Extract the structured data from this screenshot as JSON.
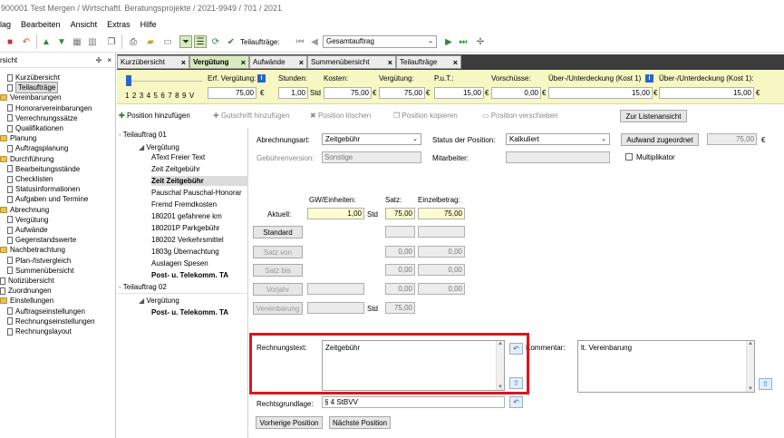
{
  "window": {
    "title": "900001 Test Mergen / Wirtschaftl. Beratungsprojekte / 2021-9949 / 701 / 2021"
  },
  "menu": [
    "lag",
    "Bearbeiten",
    "Ansicht",
    "Extras",
    "Hilfe"
  ],
  "toolbar": {
    "teilauftraege_label": "Teilaufträge:",
    "teilauftrag_value": "Gesamtauftrag"
  },
  "left_panel": {
    "header": "rsicht",
    "items": [
      {
        "label": "Kurzübersicht",
        "type": "doc",
        "indent": 1
      },
      {
        "label": "Teilaufträge",
        "type": "doc",
        "indent": 1,
        "selected": true
      },
      {
        "label": "Vereinbarungen",
        "type": "folder",
        "indent": 0
      },
      {
        "label": "Honorarvereinbarungen",
        "type": "doc",
        "indent": 1
      },
      {
        "label": "Verrechnungssätze",
        "type": "doc",
        "indent": 1
      },
      {
        "label": "Qualifikationen",
        "type": "doc",
        "indent": 1
      },
      {
        "label": "Planung",
        "type": "folder",
        "indent": 0
      },
      {
        "label": "Auftragsplanung",
        "type": "doc",
        "indent": 1
      },
      {
        "label": "Durchführung",
        "type": "folder",
        "indent": 0
      },
      {
        "label": "Bearbeitungsstände",
        "type": "doc",
        "indent": 1
      },
      {
        "label": "Checklisten",
        "type": "doc",
        "indent": 1
      },
      {
        "label": "Statusinformationen",
        "type": "doc",
        "indent": 1
      },
      {
        "label": "Aufgaben und Termine",
        "type": "doc",
        "indent": 1
      },
      {
        "label": "Abrechnung",
        "type": "folder",
        "indent": 0
      },
      {
        "label": "Vergütung",
        "type": "doc",
        "indent": 1
      },
      {
        "label": "Aufwände",
        "type": "doc",
        "indent": 1
      },
      {
        "label": "Gegenstandswerte",
        "type": "doc",
        "indent": 1
      },
      {
        "label": "Nachbetrachtung",
        "type": "folder",
        "indent": 0
      },
      {
        "label": "Plan-/Istvergleich",
        "type": "doc",
        "indent": 1
      },
      {
        "label": "Summenübersicht",
        "type": "doc",
        "indent": 1
      },
      {
        "label": "Notizübersicht",
        "type": "doc",
        "indent": 0
      },
      {
        "label": "Zuordnungen",
        "type": "doc",
        "indent": 0
      },
      {
        "label": "Einstellungen",
        "type": "folder",
        "indent": 0
      },
      {
        "label": "Auftragseinstellungen",
        "type": "doc",
        "indent": 1
      },
      {
        "label": "Rechnungseinstellungen",
        "type": "doc",
        "indent": 1
      },
      {
        "label": "Rechnungslayout",
        "type": "doc",
        "indent": 1
      }
    ]
  },
  "tabs": [
    {
      "label": "Kurzübersicht",
      "active": false
    },
    {
      "label": "Vergütung",
      "active": true
    },
    {
      "label": "Aufwände",
      "active": false
    },
    {
      "label": "Summenübersicht",
      "active": false
    },
    {
      "label": "Teilaufträge",
      "active": false
    }
  ],
  "summary": {
    "slider_scale": "1 2 3 4 5 6 7 8 9 V",
    "erf_verguetung_label": "Erf. Vergütung:",
    "erf_verguetung": "75,00",
    "erf_unit": "€",
    "stunden_label": "Stunden:",
    "stunden": "1,00",
    "stunden_unit": "Std",
    "kosten_label": "Kosten:",
    "kosten": "75,00",
    "kosten_unit": "€",
    "verguetung_label": "Vergütung:",
    "verguetung": "75,00",
    "verguetung_unit": "€",
    "put_label": "P.u.T.:",
    "put": "15,00",
    "put_unit": "€",
    "vorschuesse_label": "Vorschüsse:",
    "vorschuesse": "0,00",
    "vorschuesse_unit": "€",
    "ueber1_label": "Über-/Unterdeckung (Kost 1)",
    "ueber1": "15,00",
    "ueber1_unit": "€",
    "ueber2_label": "Über-/Unterdeckung (Kost 1):",
    "ueber2": "15,00",
    "ueber2_unit": "€"
  },
  "actions": {
    "add": "Position hinzufügen",
    "credit": "Gutschrift hinzufügen",
    "delete": "Position löschen",
    "copy": "Position kopieren",
    "move": "Position verschieben",
    "list_view": "Zur Listenansicht"
  },
  "positions": [
    {
      "label": "Teilauftrag 01",
      "level": 0,
      "expand": "-"
    },
    {
      "label": "Vergütung",
      "level": 1,
      "expand": "◢"
    },
    {
      "label": "AText Freier Text",
      "level": 2
    },
    {
      "label": "Zeit Zeitgebühr",
      "level": 2
    },
    {
      "label": "Zeit Zeitgebühr",
      "level": 2,
      "selected": true
    },
    {
      "label": "Pauschal Pauschal-Honorar",
      "level": 2
    },
    {
      "label": "Fremd Fremdkosten",
      "level": 2
    },
    {
      "label": "180201 gefahrene km",
      "level": 2
    },
    {
      "label": "180201P Parkgebühr",
      "level": 2
    },
    {
      "label": "180202 Verkehrsmittel",
      "level": 2
    },
    {
      "label": "1803g Übernachtung",
      "level": 2
    },
    {
      "label": "Auslagen Spesen",
      "level": 2
    },
    {
      "label": "Post- u. Telekomm. TA",
      "level": 2,
      "bold": true
    },
    {
      "label": "Teilauftrag 02",
      "level": 0,
      "expand": "-"
    },
    {
      "label": "Vergütung",
      "level": 1,
      "expand": "◢"
    },
    {
      "label": "Post- u. Telekomm. TA",
      "level": 2,
      "bold": true
    }
  ],
  "form": {
    "abrechnungsart_label": "Abrechnungsart:",
    "abrechnungsart": "Zeitgebühr",
    "status_label": "Status der Position:",
    "status": "Kalkuliert",
    "aufwand_button": "Aufwand zugeordnet",
    "aufwand_value": "75,00",
    "aufwand_unit": "€",
    "gebuehrenversion_label": "Gebührenversion:",
    "gebuehrenversion": "Sonstige",
    "mitarbeiter_label": "Mitarbeiter:",
    "mitarbeiter": "",
    "multiplikator_label": "Multiplikator",
    "gw_header": "GW/Einheiten:",
    "satz_header": "Satz:",
    "einzel_header": "Einzelbetrag:",
    "aktuell_label": "Aktuell:",
    "aktuell_gw": "1,00",
    "aktuell_unit": "Std",
    "aktuell_satz": "75,00",
    "aktuell_einzel": "75,00",
    "standard_button": "Standard",
    "satz_von_button": "Satz von",
    "satz_von_satz": "0,00",
    "satz_von_einzel": "0,00",
    "satz_bis_button": "Satz bis",
    "satz_bis_satz": "0,00",
    "satz_bis_einzel": "0,00",
    "vorjahr_button": "Vorjahr",
    "vorjahr_satz": "0,00",
    "vorjahr_einzel": "0,00",
    "vereinbarung_button": "Vereinbarung",
    "vereinbarung_unit": "Std",
    "vereinbarung_satz": "75,00",
    "rechnungstext_label": "Rechnungstext:",
    "rechnungstext": "Zeitgebühr",
    "kommentar_label": "Kommentar:",
    "kommentar": "lt. Vereinbarung",
    "rechtsgrundlage_label": "Rechtsgrundlage:",
    "rechtsgrundlage": "§ 4 StBVV",
    "prev_button": "Vorherige Position",
    "next_button": "Nächste Position"
  },
  "colors": {
    "accent_green": "#d7ebbf",
    "summary_yellow": "#f7f7c4",
    "highlight_red": "#e0141b"
  }
}
